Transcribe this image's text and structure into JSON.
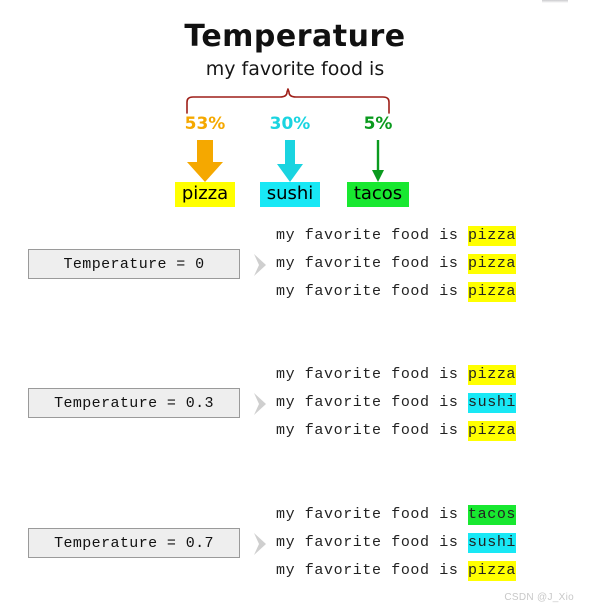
{
  "header": {
    "title": "Temperature",
    "subtitle": "my favorite food is"
  },
  "brace": {
    "color": "#9e1f18"
  },
  "distribution": {
    "items": [
      {
        "percent": "53%",
        "percent_color": "#f5a800",
        "label": "pizza",
        "chip_bg": "#ffff00",
        "arrow_color": "#f5a800",
        "arrow_style": "thick"
      },
      {
        "percent": "30%",
        "percent_color": "#1ad4e0",
        "label": "sushi",
        "chip_bg": "#18e8f5",
        "arrow_color": "#1ad4e0",
        "arrow_style": "medium"
      },
      {
        "percent": "5%",
        "percent_color": "#0a9a1e",
        "label": "tacos",
        "chip_bg": "#18e830",
        "arrow_color": "#0a9a1e",
        "arrow_style": "thin"
      }
    ]
  },
  "highlight_colors": {
    "pizza": "#ffff00",
    "sushi": "#18e8f5",
    "tacos": "#18e830"
  },
  "groups": [
    {
      "temperature_label": "Temperature = 0",
      "chevron": "chevron-right-icon",
      "samples": [
        {
          "prefix": "my favorite food is ",
          "word": "pizza",
          "highlight": "#ffff00"
        },
        {
          "prefix": "my favorite food is ",
          "word": "pizza",
          "highlight": "#ffff00"
        },
        {
          "prefix": "my favorite food is ",
          "word": "pizza",
          "highlight": "#ffff00"
        }
      ]
    },
    {
      "temperature_label": "Temperature = 0.3",
      "chevron": "chevron-right-icon",
      "samples": [
        {
          "prefix": "my favorite food is ",
          "word": "pizza",
          "highlight": "#ffff00"
        },
        {
          "prefix": "my favorite food is ",
          "word": "sushi",
          "highlight": "#18e8f5"
        },
        {
          "prefix": "my favorite food is ",
          "word": "pizza",
          "highlight": "#ffff00"
        }
      ]
    },
    {
      "temperature_label": "Temperature = 0.7",
      "chevron": "chevron-right-icon",
      "samples": [
        {
          "prefix": "my favorite food is ",
          "word": "tacos",
          "highlight": "#18e830"
        },
        {
          "prefix": "my favorite food is ",
          "word": "sushi",
          "highlight": "#18e8f5"
        },
        {
          "prefix": "my favorite food is ",
          "word": "pizza",
          "highlight": "#ffff00"
        }
      ]
    }
  ],
  "watermark": {
    "text": "CSDN @J_Xio"
  }
}
